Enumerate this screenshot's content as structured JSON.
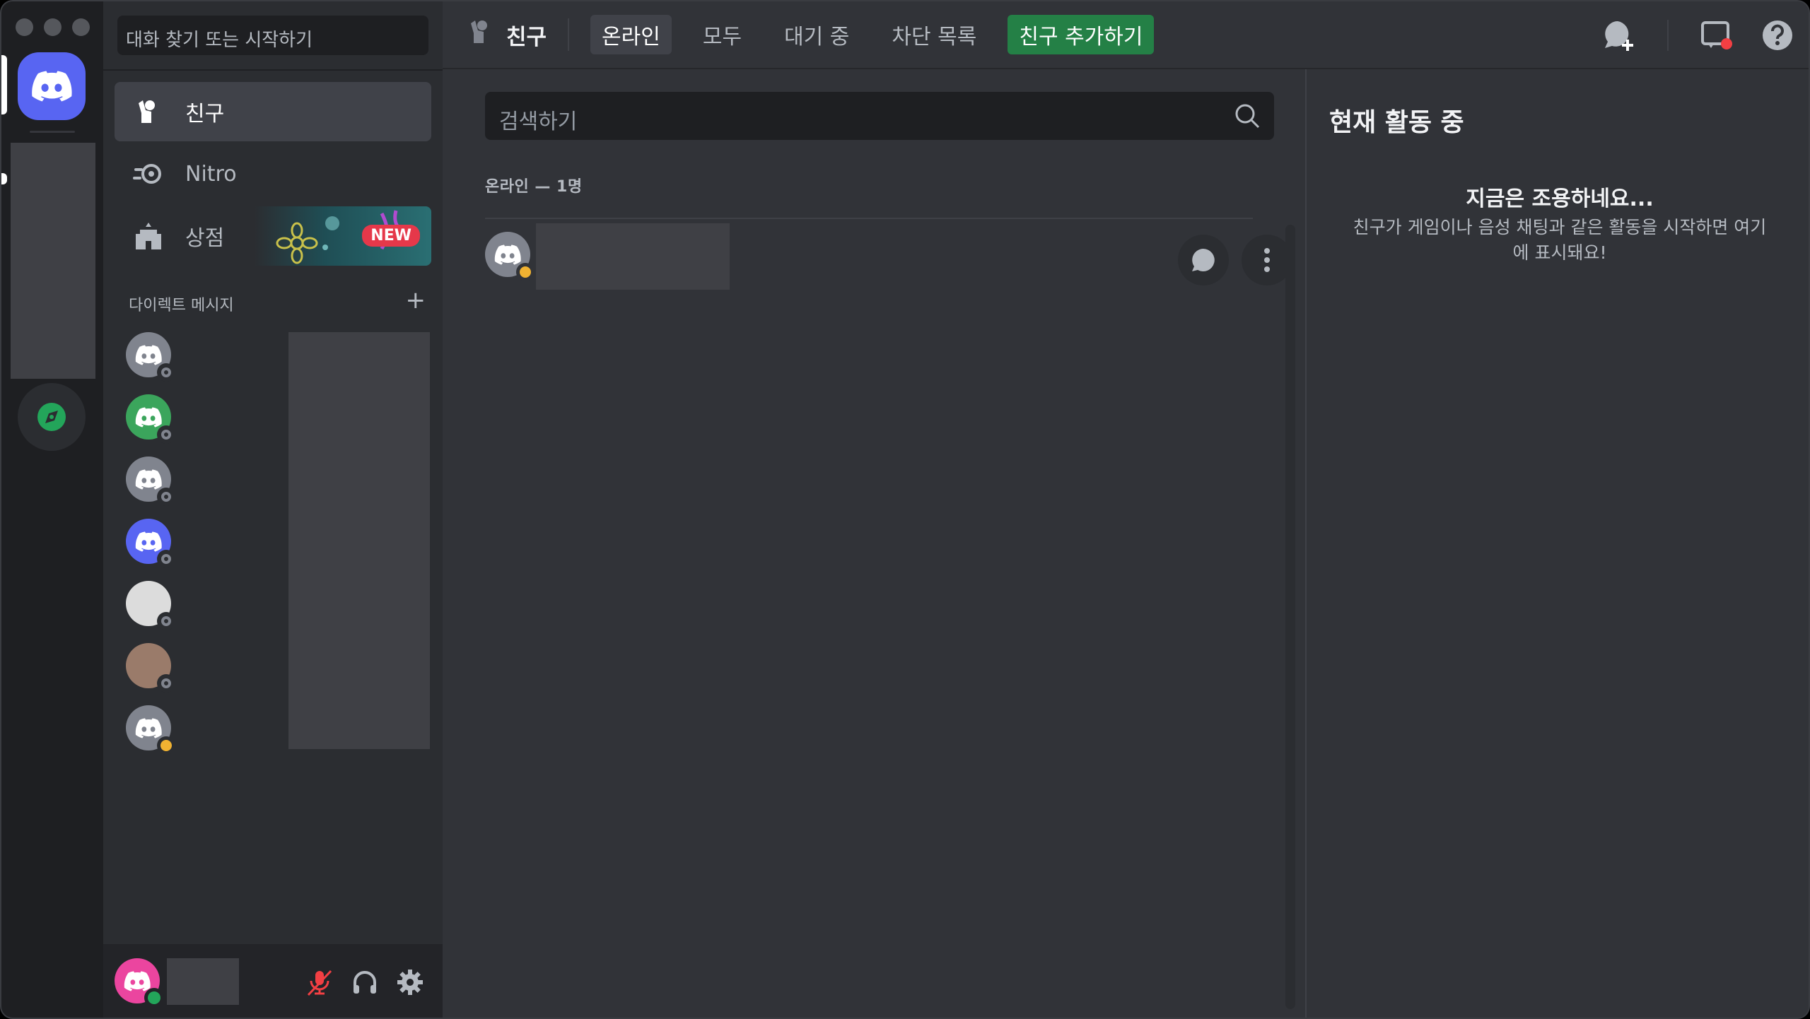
{
  "sidebar": {
    "search_placeholder": "대화 찾기 또는 시작하기",
    "nav": {
      "friends": "친구",
      "nitro": "Nitro",
      "shop": "상점",
      "shop_badge": "NEW"
    },
    "dm_header": "다이렉트 메시지",
    "dm_add": "+",
    "dms": [
      {
        "color": "#80848e",
        "status": "offline"
      },
      {
        "color": "#3ba55c",
        "status": "offline"
      },
      {
        "color": "#80848e",
        "status": "offline"
      },
      {
        "color": "#5865f2",
        "status": "offline"
      },
      {
        "color": "#dcdcdc",
        "status": "offline"
      },
      {
        "color": "#9a7b6a",
        "status": "offline"
      },
      {
        "color": "#80848e",
        "status": "idle"
      }
    ]
  },
  "topbar": {
    "title": "친구",
    "tabs": {
      "online": "온라인",
      "all": "모두",
      "pending": "대기 중",
      "blocked": "차단 목록",
      "add_friend": "친구 추가하기"
    }
  },
  "main": {
    "search_placeholder": "검색하기",
    "count_label": "온라인 — 1명"
  },
  "activity": {
    "title": "현재 활동 중",
    "empty_title": "지금은 조용하네요...",
    "empty_desc": "친구가 게임이나 음성 채팅과 같은 활동을 시작하면 여기에 표시돼요!"
  },
  "colors": {
    "brand": "#5865f2",
    "add_friend_green": "#248046",
    "idle": "#f0b232",
    "online": "#23a55a",
    "muted_red": "#f23f43"
  }
}
